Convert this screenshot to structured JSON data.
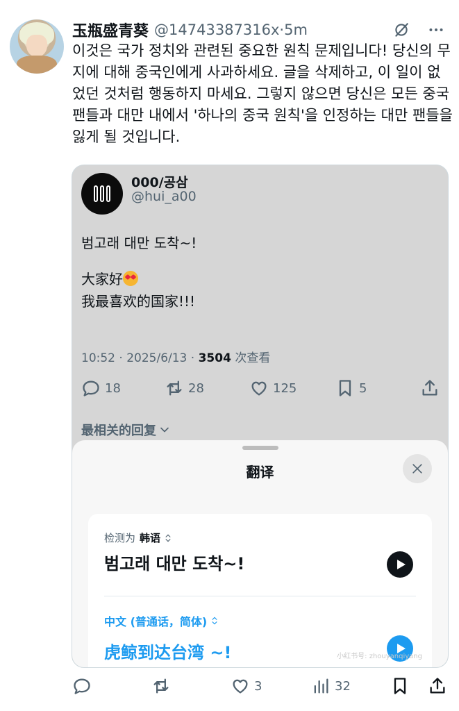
{
  "tweet": {
    "display_name": "玉瓶盛青葵",
    "handle": "@14743387316x",
    "separator": "·",
    "time": "5m",
    "text": "이것은 국가 정치와 관련된 중요한 원칙 문제입니다! 당신의 무지에 대해 중국인에게 사과하세요. 글을 삭제하고, 이 일이 없었던 것처럼 행동하지 마세요. 그렇지 않으면 당신은 모든 중국 팬들과 대만 내에서 '하나의 중국 원칙'을 인정하는 대만 팬들을 잃게 될 것입니다."
  },
  "quote": {
    "display_name": "000/공삼",
    "handle": "@hui_a00",
    "line1": "범고래 대만 도착~!",
    "line2": "大家好",
    "line3": "我最喜欢的国家!!!",
    "time_date": "10:52 · 2025/6/13 · ",
    "views_count": "3504",
    "views_label": " 次查看",
    "actions": {
      "replies": "18",
      "reposts": "28",
      "likes": "125",
      "bookmarks": "5"
    },
    "relevant_label": "最相关的回复"
  },
  "translate_sheet": {
    "title": "翻译",
    "detected_prefix": "检测为",
    "detected_lang": "韩语",
    "source_text": "범고래 대만 도착~!",
    "target_lang": "中文 (普通话，简体)",
    "target_text": "虎鲸到达台湾 ~!",
    "watermark": "小红书号: zhouyanqiyang"
  },
  "bottom_actions": {
    "likes": "3",
    "views": "32"
  },
  "colors": {
    "accent": "#1d9bf0",
    "text": "#0f1419",
    "muted": "#536471"
  },
  "icons": [
    "grok-icon",
    "more-icon",
    "reply-icon",
    "repost-icon",
    "like-icon",
    "bookmark-icon",
    "share-icon",
    "chevron-down-icon",
    "close-icon",
    "play-icon",
    "views-icon"
  ]
}
